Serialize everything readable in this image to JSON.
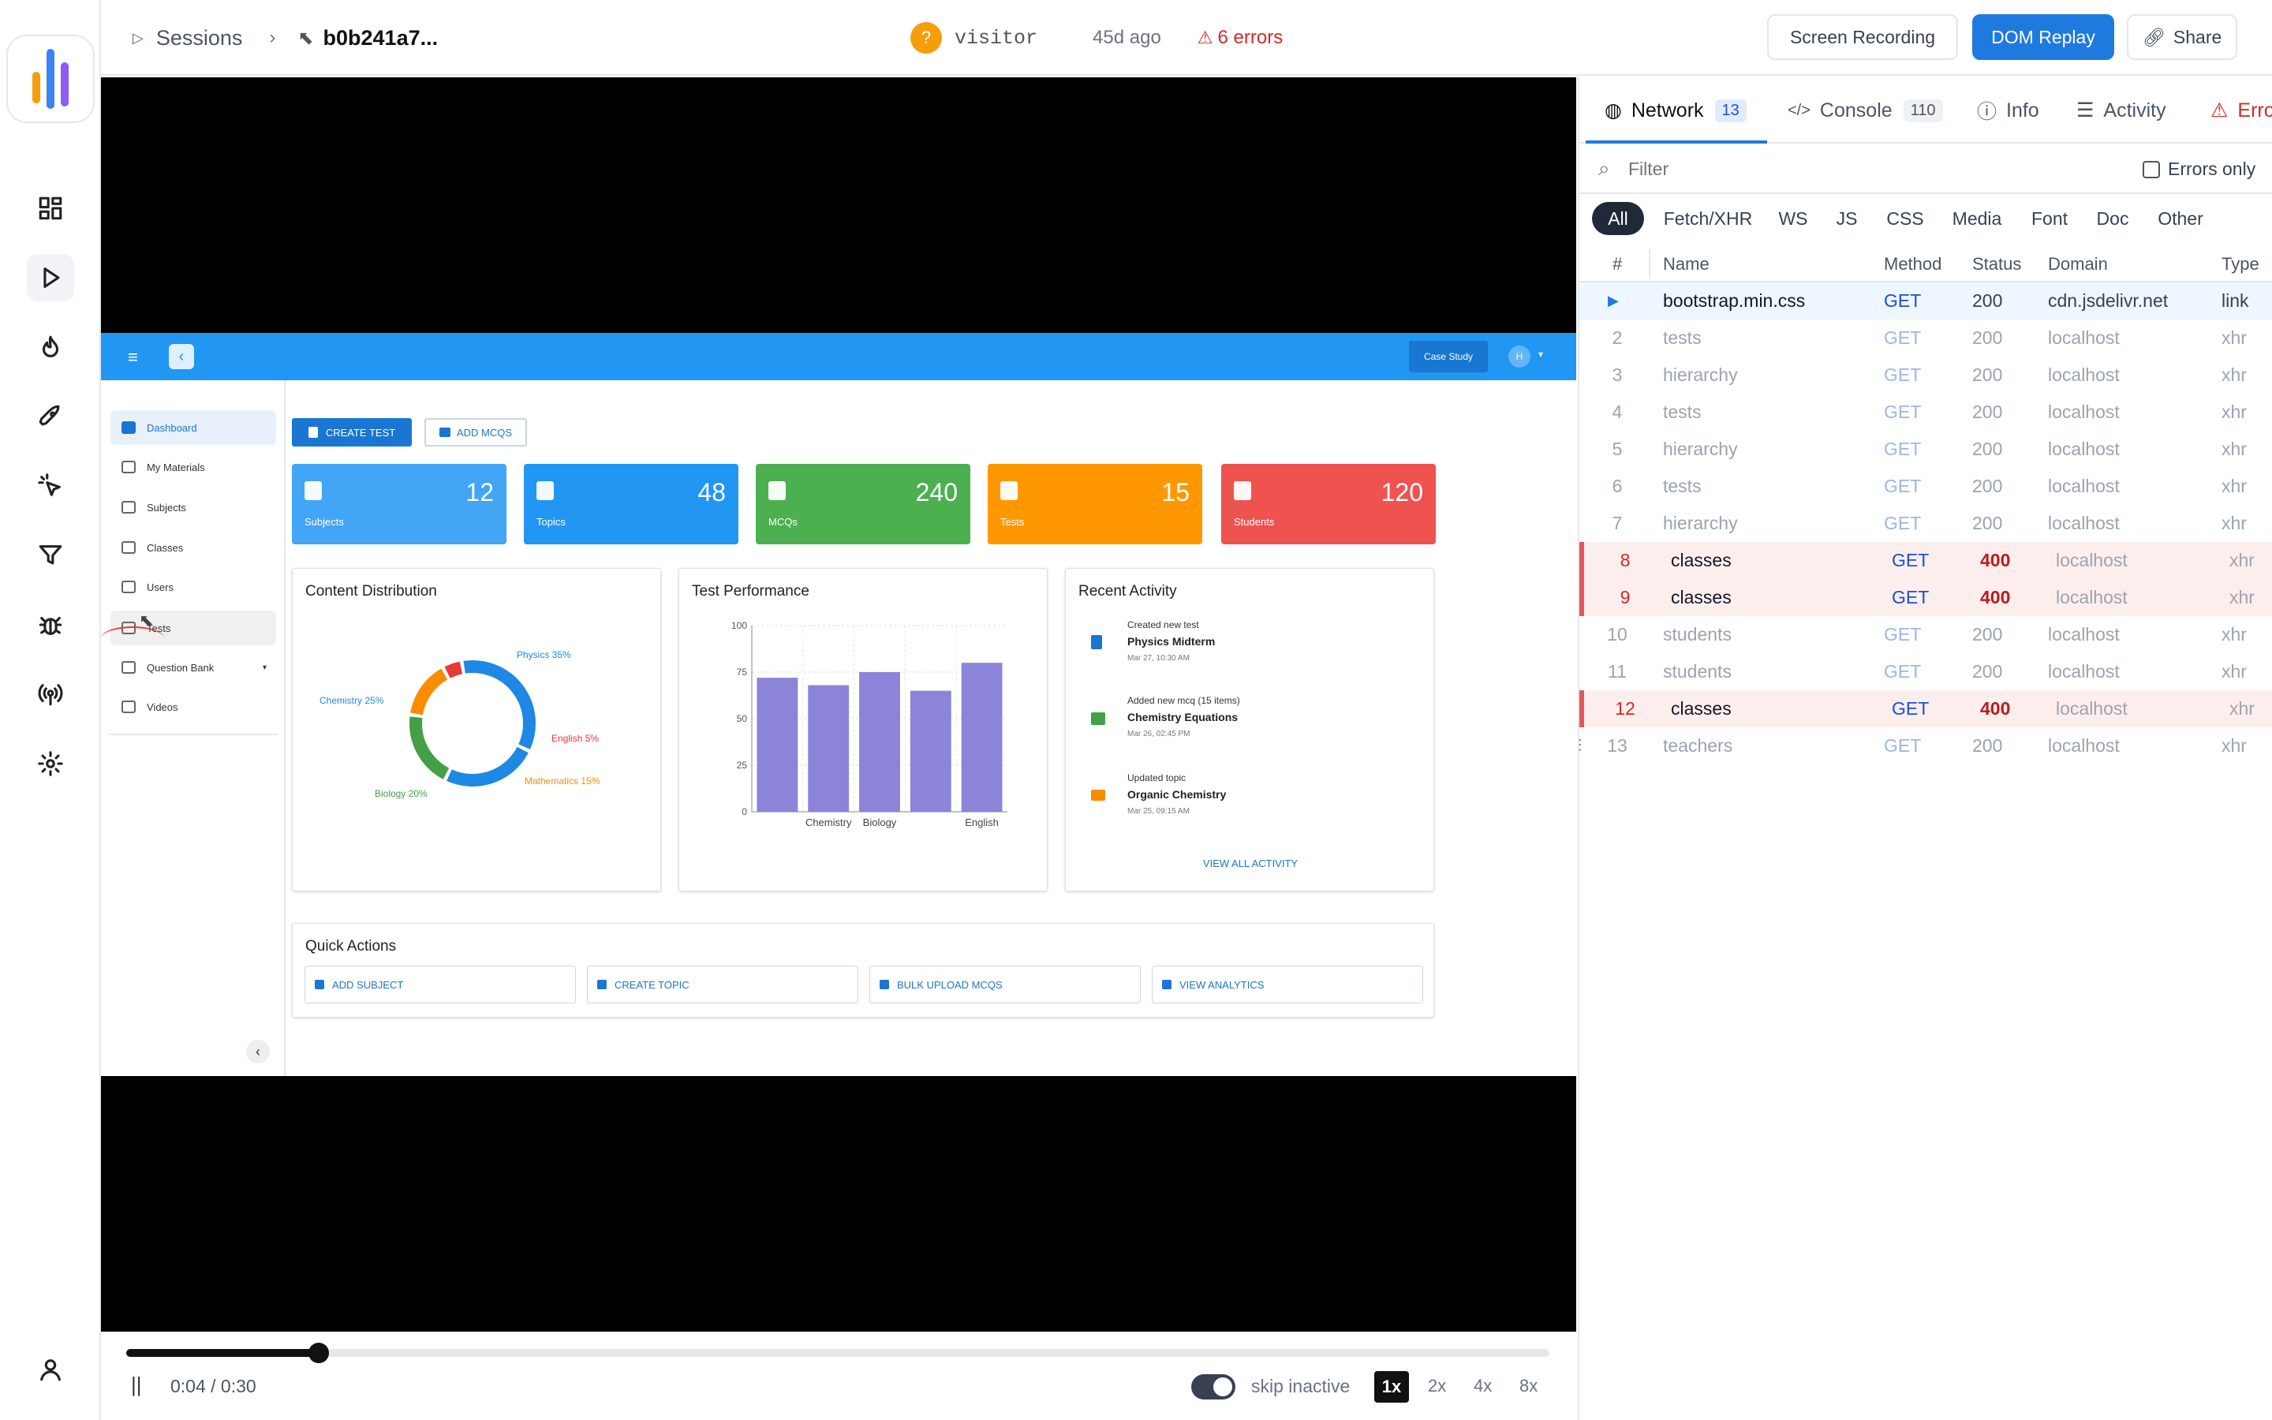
{
  "header": {
    "sessions": "Sessions",
    "session_id": "b0b241a7...",
    "visitor_avatar": "?",
    "visitor": "visitor",
    "age": "45d ago",
    "errors": "6 errors",
    "screen_recording": "Screen Recording",
    "dom_replay": "DOM Replay",
    "share": "Share"
  },
  "colors": {
    "accent": "#1f7ae0",
    "error": "#dc2626",
    "app_bar": "#2196f3"
  },
  "app": {
    "case_study": "Case Study",
    "avatar": "H",
    "create_test": "CREATE TEST",
    "add_mcqs": "ADD MCQS",
    "nav": [
      "Dashboard",
      "My Materials",
      "Subjects",
      "Classes",
      "Users",
      "Tests",
      "Question Bank",
      "Videos"
    ],
    "stats": [
      {
        "value": "12",
        "label": "Subjects",
        "color": "#42a5f5"
      },
      {
        "value": "48",
        "label": "Topics",
        "color": "#2196f3"
      },
      {
        "value": "240",
        "label": "MCQs",
        "color": "#4caf50"
      },
      {
        "value": "15",
        "label": "Tests",
        "color": "#ff9800"
      },
      {
        "value": "120",
        "label": "Students",
        "color": "#ef5350"
      }
    ],
    "content_distribution": {
      "title": "Content Distribution",
      "labels": [
        "Physics 35%",
        "Chemistry 25%",
        "English 5%",
        "Biology 20%",
        "Mathematics 15%"
      ]
    },
    "test_performance": {
      "title": "Test Performance"
    },
    "recent_activity": {
      "title": "Recent Activity",
      "items": [
        {
          "action": "Created new test",
          "name": "Physics Midterm",
          "time": "Mar 27, 10:30 AM"
        },
        {
          "action": "Added new mcq (15 items)",
          "name": "Chemistry Equations",
          "time": "Mar 26, 02:45 PM"
        },
        {
          "action": "Updated topic",
          "name": "Organic Chemistry",
          "time": "Mar 25, 09:15 AM"
        }
      ],
      "view_all": "VIEW ALL ACTIVITY"
    },
    "quick_actions": {
      "title": "Quick Actions",
      "items": [
        "ADD SUBJECT",
        "CREATE TOPIC",
        "BULK UPLOAD MCQS",
        "VIEW ANALYTICS"
      ]
    }
  },
  "chart_data": [
    {
      "type": "pie",
      "title": "Content Distribution",
      "categories": [
        "Physics",
        "Chemistry",
        "Biology",
        "Mathematics",
        "English"
      ],
      "values": [
        35,
        25,
        20,
        15,
        5
      ],
      "colors": [
        "#1e88e5",
        "#1e88e5",
        "#43a047",
        "#fb8c00",
        "#e53935"
      ]
    },
    {
      "type": "bar",
      "title": "Test Performance",
      "categories": [
        "",
        "Chemistry",
        "Biology",
        "",
        "English"
      ],
      "values": [
        72,
        68,
        75,
        65,
        80
      ],
      "ylim": [
        0,
        100
      ],
      "yticks": [
        "0",
        "25",
        "50",
        "75",
        "100"
      ],
      "grid": true,
      "color": "#8c84d8"
    }
  ],
  "player": {
    "time": "0:04 / 0:30",
    "progress": 0.135,
    "skip_inactive": "skip inactive",
    "speeds": [
      "1x",
      "2x",
      "4x",
      "8x"
    ]
  },
  "panel": {
    "tabs": [
      {
        "label": "Network",
        "count": "13"
      },
      {
        "label": "Console",
        "count": "110"
      },
      {
        "label": "Info"
      },
      {
        "label": "Activity"
      },
      {
        "label": "Errors"
      }
    ],
    "filter_placeholder": "Filter",
    "errors_only": "Errors only",
    "types": [
      "All",
      "Fetch/XHR",
      "WS",
      "JS",
      "CSS",
      "Media",
      "Font",
      "Doc",
      "Other"
    ],
    "columns": [
      "#",
      "Name",
      "Method",
      "Status",
      "Domain",
      "Type"
    ],
    "rows": [
      {
        "n": "",
        "name": "bootstrap.min.css",
        "method": "GET",
        "status": "200",
        "domain": "cdn.jsdelivr.net",
        "type": "link",
        "kind": "first"
      },
      {
        "n": "2",
        "name": "tests",
        "method": "GET",
        "status": "200",
        "domain": "localhost",
        "type": "xhr",
        "kind": ""
      },
      {
        "n": "3",
        "name": "hierarchy",
        "method": "GET",
        "status": "200",
        "domain": "localhost",
        "type": "xhr",
        "kind": ""
      },
      {
        "n": "4",
        "name": "tests",
        "method": "GET",
        "status": "200",
        "domain": "localhost",
        "type": "xhr",
        "kind": ""
      },
      {
        "n": "5",
        "name": "hierarchy",
        "method": "GET",
        "status": "200",
        "domain": "localhost",
        "type": "xhr",
        "kind": ""
      },
      {
        "n": "6",
        "name": "tests",
        "method": "GET",
        "status": "200",
        "domain": "localhost",
        "type": "xhr",
        "kind": ""
      },
      {
        "n": "7",
        "name": "hierarchy",
        "method": "GET",
        "status": "200",
        "domain": "localhost",
        "type": "xhr",
        "kind": ""
      },
      {
        "n": "8",
        "name": "classes",
        "method": "GET",
        "status": "400",
        "domain": "localhost",
        "type": "xhr",
        "kind": "err"
      },
      {
        "n": "9",
        "name": "classes",
        "method": "GET",
        "status": "400",
        "domain": "localhost",
        "type": "xhr",
        "kind": "err"
      },
      {
        "n": "10",
        "name": "students",
        "method": "GET",
        "status": "200",
        "domain": "localhost",
        "type": "xhr",
        "kind": ""
      },
      {
        "n": "11",
        "name": "students",
        "method": "GET",
        "status": "200",
        "domain": "localhost",
        "type": "xhr",
        "kind": ""
      },
      {
        "n": "12",
        "name": "classes",
        "method": "GET",
        "status": "400",
        "domain": "localhost",
        "type": "xhr",
        "kind": "err"
      },
      {
        "n": "13",
        "name": "teachers",
        "method": "GET",
        "status": "200",
        "domain": "localhost",
        "type": "xhr",
        "kind": ""
      }
    ]
  }
}
